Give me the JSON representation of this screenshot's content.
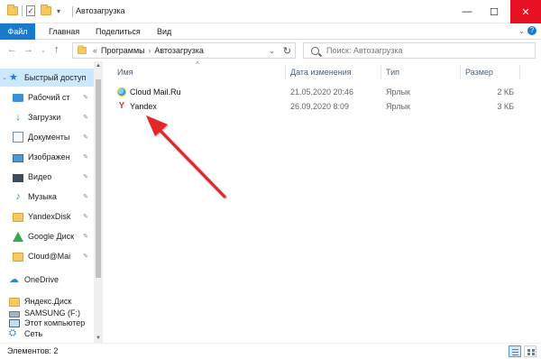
{
  "window": {
    "title": "Автозагрузка",
    "controls": {
      "minimize": "—",
      "maximize": "☐",
      "close": "✕"
    }
  },
  "quick_access_toolbar": {
    "icons": [
      "folder-icon",
      "properties-icon",
      "new-folder-icon",
      "dropdown-icon"
    ]
  },
  "ribbon": {
    "tabs": [
      "Файл",
      "Главная",
      "Поделиться",
      "Вид"
    ],
    "active_color": "#1979ca"
  },
  "address": {
    "prefix": "«",
    "crumbs": [
      "Программы",
      "Автозагрузка"
    ],
    "separator": "›",
    "search_placeholder": "Поиск: Автозагрузка"
  },
  "nav_pane": {
    "items": [
      {
        "label": "Быстрый доступ",
        "icon": "star-icon",
        "selected": true
      },
      {
        "label": "Рабочий ст",
        "icon": "desktop-icon",
        "pinned": true
      },
      {
        "label": "Загрузки",
        "icon": "downloads-icon",
        "pinned": true
      },
      {
        "label": "Документы",
        "icon": "documents-icon",
        "pinned": true
      },
      {
        "label": "Изображен",
        "icon": "pictures-icon",
        "pinned": true
      },
      {
        "label": "Видео",
        "icon": "video-icon",
        "pinned": true
      },
      {
        "label": "Музыка",
        "icon": "music-icon",
        "pinned": true
      },
      {
        "label": "YandexDisk",
        "icon": "yandexdisk-folder-icon",
        "pinned": true
      },
      {
        "label": "Google Диск",
        "icon": "google-drive-icon",
        "pinned": true
      },
      {
        "label": "Cloud@Mai",
        "icon": "cloud-mail-folder-icon",
        "pinned": true
      },
      {
        "label": "OneDrive",
        "icon": "onedrive-icon"
      },
      {
        "label": "Яндекс.Диск",
        "icon": "yandex-disk-icon"
      },
      {
        "label": "Этот компьютер",
        "icon": "this-pc-icon"
      },
      {
        "label": "SAMSUNG (F:)",
        "icon": "drive-icon"
      },
      {
        "label": "Сеть",
        "icon": "network-icon"
      }
    ],
    "pin_glyph": "📌"
  },
  "file_list": {
    "columns": {
      "name": "Имя",
      "date": "Дата изменения",
      "type": "Тип",
      "size": "Размер"
    },
    "rows": [
      {
        "name": "Cloud Mail.Ru",
        "date": "21.05.2020 20:46",
        "type": "Ярлык",
        "size": "2 КБ",
        "icon": "cloud-mail-icon"
      },
      {
        "name": "Yandex",
        "date": "26.09.2020 8:09",
        "type": "Ярлык",
        "size": "3 КБ",
        "icon": "yandex-icon"
      }
    ]
  },
  "status_bar": {
    "item_count": "Элементов: 2"
  },
  "annotation": {
    "arrow_color": "#e3262b"
  }
}
